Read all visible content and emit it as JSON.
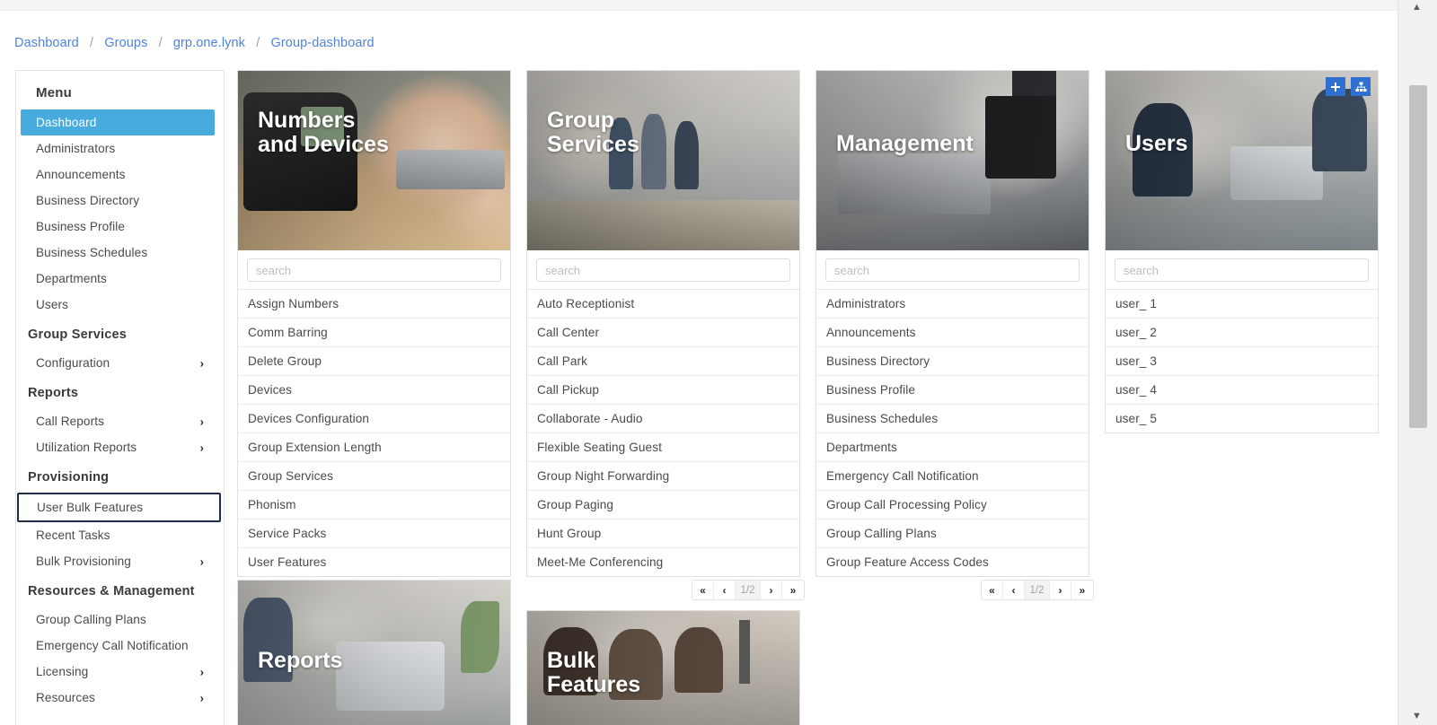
{
  "breadcrumb": {
    "items": [
      "Dashboard",
      "Groups",
      "grp.one.lynk",
      "Group-dashboard"
    ],
    "separator": "/"
  },
  "sidebar": {
    "title": "Menu",
    "entries": [
      {
        "type": "item",
        "label": "Dashboard",
        "state": "active"
      },
      {
        "type": "item",
        "label": "Administrators",
        "state": "normal"
      },
      {
        "type": "item",
        "label": "Announcements",
        "state": "normal"
      },
      {
        "type": "item",
        "label": "Business Directory",
        "state": "normal"
      },
      {
        "type": "item",
        "label": "Business Profile",
        "state": "normal"
      },
      {
        "type": "item",
        "label": "Business Schedules",
        "state": "normal"
      },
      {
        "type": "item",
        "label": "Departments",
        "state": "normal"
      },
      {
        "type": "item",
        "label": "Users",
        "state": "normal"
      },
      {
        "type": "section",
        "label": "Group Services"
      },
      {
        "type": "item",
        "label": "Configuration",
        "state": "normal",
        "chevron": true
      },
      {
        "type": "section",
        "label": "Reports"
      },
      {
        "type": "item",
        "label": "Call Reports",
        "state": "normal",
        "chevron": true
      },
      {
        "type": "item",
        "label": "Utilization Reports",
        "state": "normal",
        "chevron": true
      },
      {
        "type": "section",
        "label": "Provisioning"
      },
      {
        "type": "item",
        "label": "User Bulk Features",
        "state": "focused"
      },
      {
        "type": "item",
        "label": "Recent Tasks",
        "state": "normal"
      },
      {
        "type": "item",
        "label": "Bulk Provisioning",
        "state": "normal",
        "chevron": true
      },
      {
        "type": "section",
        "label": "Resources & Management"
      },
      {
        "type": "item",
        "label": "Group Calling Plans",
        "state": "normal"
      },
      {
        "type": "item",
        "label": "Emergency Call Notification",
        "state": "normal"
      },
      {
        "type": "item",
        "label": "Licensing",
        "state": "normal",
        "chevron": true
      },
      {
        "type": "item",
        "label": "Resources",
        "state": "normal",
        "chevron": true
      }
    ],
    "chevron_glyph": "›"
  },
  "cards": [
    {
      "id": "numbers-and-devices",
      "title": "Numbers\nand Devices",
      "search_placeholder": "search",
      "search_value": "",
      "items": [
        "Assign Numbers",
        "Comm Barring",
        "Delete Group",
        "Devices",
        "Devices Configuration",
        "Group Extension Length",
        "Group Services",
        "Phonism",
        "Service Packs",
        "User Features"
      ]
    },
    {
      "id": "group-services",
      "title": "Group\nServices",
      "search_placeholder": "search",
      "search_value": "",
      "items": [
        "Auto Receptionist",
        "Call Center",
        "Call Park",
        "Call Pickup",
        "Collaborate - Audio",
        "Flexible Seating Guest",
        "Group Night Forwarding",
        "Group Paging",
        "Hunt Group",
        "Meet-Me Conferencing"
      ],
      "pagination": {
        "page_label": "1/2",
        "first": "«",
        "prev": "‹",
        "next": "›",
        "last": "»"
      }
    },
    {
      "id": "management",
      "title": "Management",
      "search_placeholder": "search",
      "search_value": "",
      "items": [
        "Administrators",
        "Announcements",
        "Business Directory",
        "Business Profile",
        "Business Schedules",
        "Departments",
        "Emergency Call Notification",
        "Group Call Processing Policy",
        "Group Calling Plans",
        "Group Feature Access Codes"
      ],
      "pagination": {
        "page_label": "1/2",
        "first": "«",
        "prev": "‹",
        "next": "›",
        "last": "»"
      }
    },
    {
      "id": "users",
      "title": "Users",
      "search_placeholder": "search",
      "search_value": "",
      "items": [
        "user_ 1",
        "user_ 2",
        "user_ 3",
        "user_ 4",
        "user_ 5"
      ],
      "header_icons": [
        "add-icon",
        "sitemap-icon"
      ]
    },
    {
      "id": "reports",
      "title": "Reports"
    },
    {
      "id": "bulk-features",
      "title": "Bulk\nFeatures"
    }
  ],
  "colors": {
    "accent_blue": "#48abdd",
    "icon_button_blue": "#2f6fd0",
    "breadcrumb_link": "#4f83d9",
    "focus_outline": "#1f2d4a",
    "border": "#e0e0e0"
  },
  "scrollbar": {
    "up_glyph": "▲",
    "down_glyph": "▼"
  }
}
